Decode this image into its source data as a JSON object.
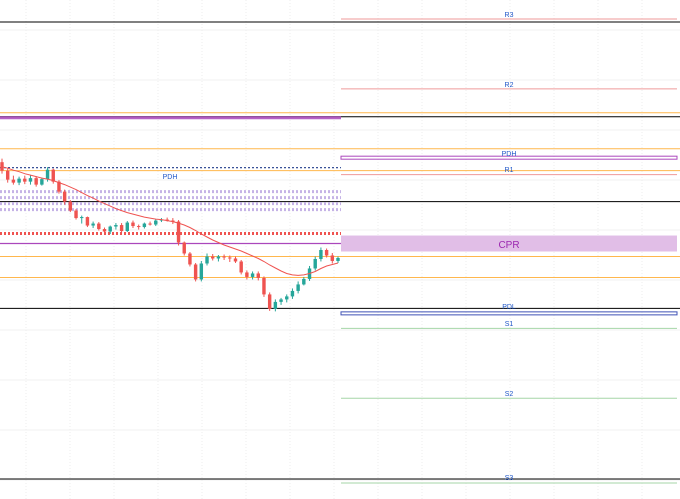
{
  "chart_data": {
    "type": "candlestick",
    "title": "",
    "xlabel": "",
    "ylabel": "",
    "grid": true,
    "price_range": [
      0,
      100
    ],
    "colors": {
      "up": "#26a69a",
      "down": "#ef5350",
      "ma": "#ef5350",
      "pivot_pink": "#ef9a9a",
      "pivot_green": "#a5d6a7",
      "cpr_fill": "#e1bee7",
      "cpr_text": "#9c27b0",
      "label_blue": "#1e56c8",
      "orange": "#ffb74d",
      "purple": "#ab47bc",
      "lavender": "#c5b3e6",
      "black": "#000000"
    },
    "levels": {
      "R3": 96.2,
      "R2": 82.2,
      "PDH_right": 68.4,
      "R1": 65.0,
      "CPR_top": 52.8,
      "CPR_bottom": 49.6,
      "PDL": 37.2,
      "S1": 34.2,
      "S2": 20.2,
      "S3": 3.2
    },
    "level_labels": {
      "r3": "R3",
      "r2": "R2",
      "pdh": "PDH",
      "r1": "R1",
      "cpr": "CPR",
      "pdl": "PDL",
      "s1": "S1",
      "s2": "S2",
      "s3": "S3",
      "pdh_left": "PDH"
    },
    "history_lines": [
      {
        "value": 95.6,
        "color": "#000000"
      },
      {
        "value": 76.6,
        "color": "#000000"
      },
      {
        "value": 59.6,
        "color": "#000000"
      },
      {
        "value": 38.2,
        "color": "#000000"
      },
      {
        "value": 4.0,
        "color": "#000000"
      },
      {
        "value": 77.4,
        "color": "#ffb74d"
      },
      {
        "value": 70.2,
        "color": "#ffb74d"
      },
      {
        "value": 65.8,
        "color": "#ffb74d"
      },
      {
        "value": 48.6,
        "color": "#ffb74d"
      },
      {
        "value": 44.4,
        "color": "#ffb74d"
      }
    ],
    "candles": [
      [
        67.5,
        68.2,
        65.2,
        65.8
      ],
      [
        65.8,
        66.2,
        63.4,
        64.0
      ],
      [
        64.0,
        64.8,
        63.0,
        63.4
      ],
      [
        63.4,
        64.6,
        62.9,
        64.2
      ],
      [
        64.2,
        64.8,
        63.1,
        63.6
      ],
      [
        63.6,
        64.9,
        63.0,
        64.3
      ],
      [
        64.3,
        64.7,
        62.6,
        63.0
      ],
      [
        63.0,
        64.4,
        62.8,
        64.1
      ],
      [
        64.1,
        66.5,
        63.6,
        66.0
      ],
      [
        66.0,
        66.2,
        63.2,
        63.6
      ],
      [
        63.6,
        63.9,
        61.2,
        61.6
      ],
      [
        61.6,
        62.0,
        59.0,
        59.6
      ],
      [
        59.6,
        59.9,
        57.5,
        57.8
      ],
      [
        57.8,
        58.1,
        56.0,
        56.3
      ],
      [
        56.3,
        56.8,
        55.2,
        56.5
      ],
      [
        56.5,
        56.6,
        54.5,
        54.8
      ],
      [
        54.8,
        55.6,
        54.3,
        55.2
      ],
      [
        55.2,
        55.5,
        53.8,
        54.1
      ],
      [
        54.1,
        54.4,
        53.4,
        53.6
      ],
      [
        53.6,
        54.8,
        53.1,
        54.6
      ],
      [
        54.6,
        55.3,
        54.0,
        54.9
      ],
      [
        54.9,
        55.3,
        53.4,
        53.7
      ],
      [
        53.7,
        55.7,
        53.5,
        55.4
      ],
      [
        55.4,
        55.8,
        54.3,
        54.7
      ],
      [
        54.7,
        55.0,
        54.0,
        54.5
      ],
      [
        54.5,
        55.4,
        54.2,
        55.2
      ],
      [
        55.2,
        55.6,
        54.8,
        55.0
      ],
      [
        55.0,
        56.1,
        54.7,
        55.8
      ],
      [
        55.8,
        56.3,
        55.5,
        56.0
      ],
      [
        56.0,
        56.4,
        55.6,
        55.8
      ],
      [
        55.8,
        56.3,
        55.1,
        55.6
      ],
      [
        55.6,
        55.9,
        50.8,
        51.4
      ],
      [
        51.4,
        51.6,
        48.8,
        49.2
      ],
      [
        49.2,
        49.5,
        46.6,
        47.0
      ],
      [
        47.0,
        47.3,
        43.6,
        44.0
      ],
      [
        44.0,
        47.7,
        43.6,
        47.2
      ],
      [
        47.2,
        49.2,
        46.8,
        48.6
      ],
      [
        48.6,
        49.1,
        47.8,
        48.2
      ],
      [
        48.2,
        48.9,
        47.6,
        48.6
      ],
      [
        48.6,
        49.0,
        47.9,
        48.4
      ],
      [
        48.4,
        48.8,
        47.5,
        48.2
      ],
      [
        48.2,
        48.6,
        47.3,
        47.6
      ],
      [
        47.6,
        47.9,
        45.0,
        45.4
      ],
      [
        45.4,
        45.8,
        44.0,
        44.5
      ],
      [
        44.5,
        45.6,
        44.0,
        45.2
      ],
      [
        45.2,
        45.6,
        43.8,
        44.3
      ],
      [
        44.3,
        44.6,
        40.5,
        41.0
      ],
      [
        41.0,
        41.4,
        37.7,
        38.1
      ],
      [
        38.1,
        40.0,
        37.6,
        39.5
      ],
      [
        39.5,
        40.3,
        38.9,
        40.0
      ],
      [
        40.0,
        41.0,
        39.4,
        40.6
      ],
      [
        40.6,
        42.2,
        40.1,
        41.7
      ],
      [
        41.7,
        43.6,
        41.2,
        43.0
      ],
      [
        43.0,
        44.5,
        42.8,
        44.1
      ],
      [
        44.1,
        46.7,
        43.7,
        46.2
      ],
      [
        46.2,
        48.6,
        45.8,
        48.1
      ],
      [
        48.1,
        50.4,
        47.6,
        49.9
      ],
      [
        49.9,
        50.2,
        48.4,
        48.8
      ],
      [
        48.8,
        49.3,
        47.2,
        47.7
      ],
      [
        47.7,
        48.6,
        47.3,
        48.3
      ]
    ],
    "moving_average": [
      66.6,
      66.3,
      65.9,
      65.6,
      65.2,
      64.9,
      64.6,
      64.3,
      64.1,
      63.8,
      63.4,
      63.0,
      62.5,
      62.0,
      61.4,
      60.8,
      60.3,
      59.7,
      59.2,
      58.7,
      58.2,
      57.8,
      57.4,
      57.1,
      56.8,
      56.5,
      56.3,
      56.1,
      56.0,
      55.8,
      55.6,
      55.3,
      54.9,
      54.4,
      53.8,
      53.1,
      52.5,
      51.9,
      51.4,
      50.9,
      50.5,
      50.1,
      49.7,
      49.2,
      48.7,
      48.2,
      47.6,
      46.9,
      46.3,
      45.7,
      45.2,
      44.9,
      44.8,
      44.9,
      45.2,
      45.6,
      46.2,
      46.7,
      47.0,
      47.3
    ],
    "dotted_bands": [
      {
        "value": 66.4,
        "color": "#1e3a8a",
        "pattern": "dash"
      },
      {
        "value": 61.6,
        "color": "#c5b3e6",
        "pattern": "dot"
      },
      {
        "value": 60.4,
        "color": "#c5b3e6",
        "pattern": "dot"
      },
      {
        "value": 59.2,
        "color": "#c5b3e6",
        "pattern": "dot"
      },
      {
        "value": 58.0,
        "color": "#c5b3e6",
        "pattern": "dot"
      },
      {
        "value": 53.2,
        "color": "#ef5350",
        "pattern": "dot"
      },
      {
        "value": 51.2,
        "color": "#ab47bc",
        "pattern": "solid"
      }
    ]
  }
}
